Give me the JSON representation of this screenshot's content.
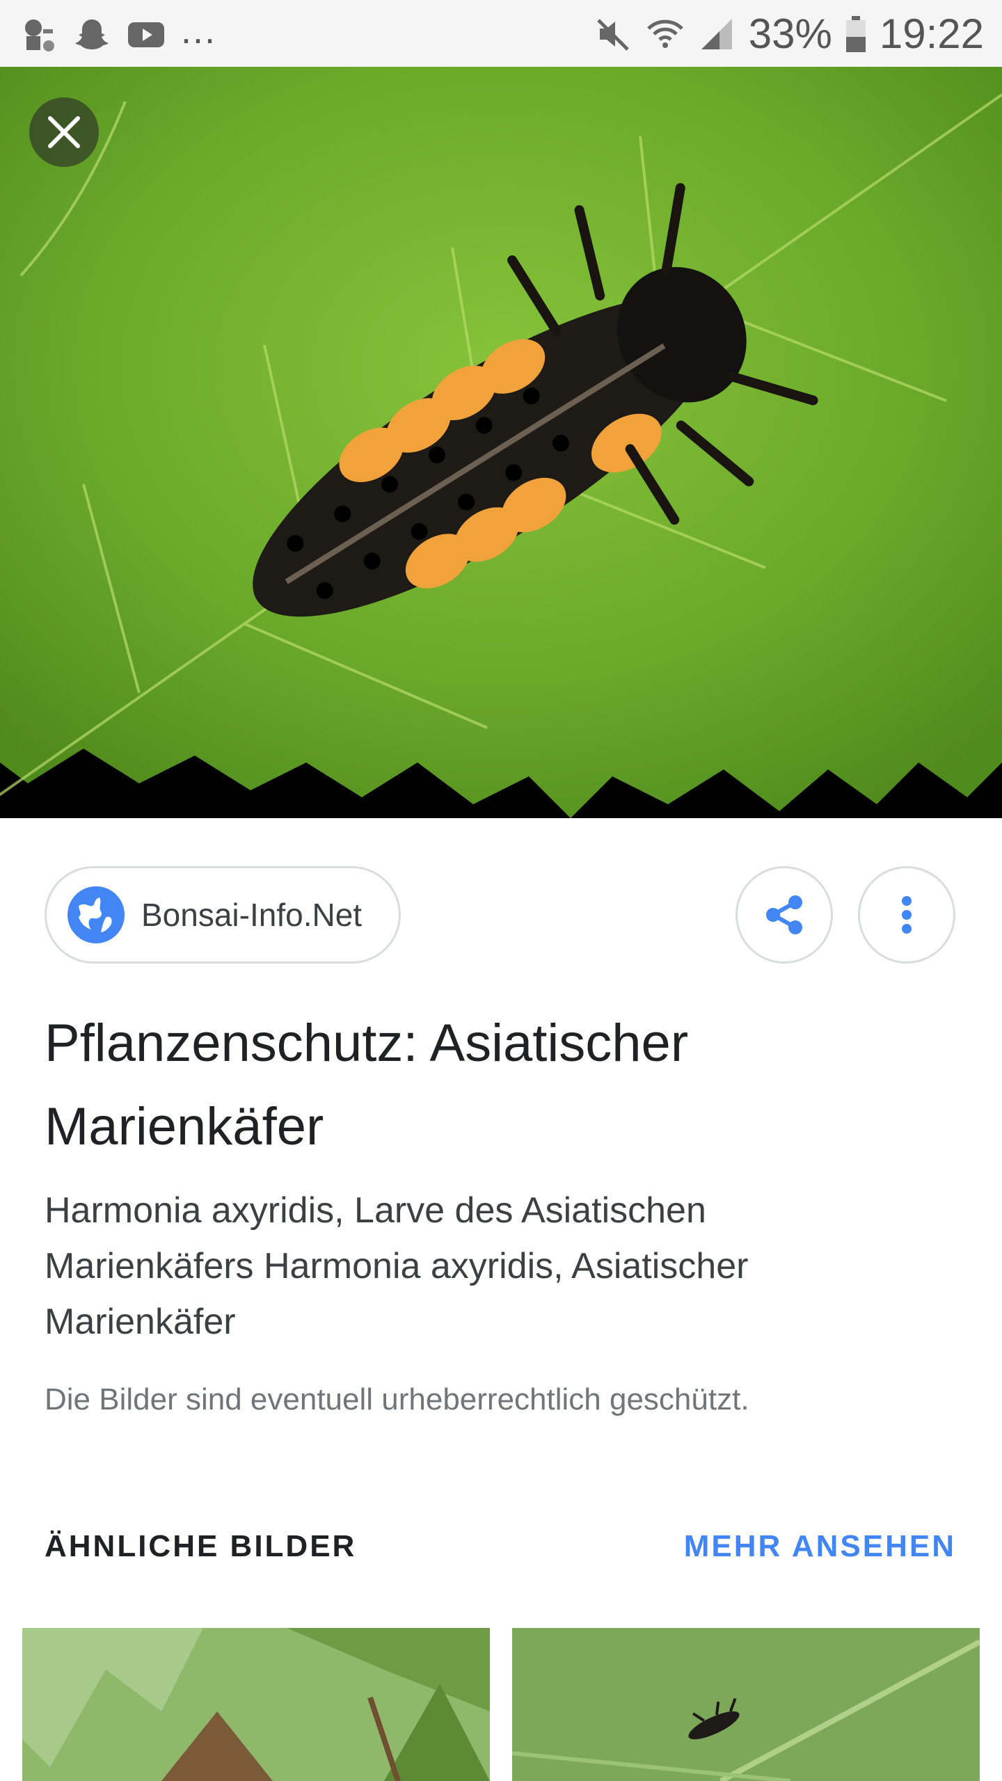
{
  "status_bar": {
    "left_icons": [
      "meme-avatar-icon",
      "snapchat-icon",
      "youtube-icon"
    ],
    "overflow": "...",
    "right_icons": [
      "mute-icon",
      "wifi-icon",
      "signal-icon"
    ],
    "battery_percent": "33%",
    "time": "19:22"
  },
  "hero": {
    "close_icon": "close-icon"
  },
  "source": {
    "site_name": "Bonsai-Info.Net",
    "site_icon": "globe-icon",
    "share_icon": "share-icon",
    "more_icon": "more-vert-icon"
  },
  "result": {
    "title": "Pflanzenschutz: Asiatischer Marienkäfer",
    "description": "Harmonia axyridis, Larve des Asiatischen Marienkäfers Harmonia axyridis, Asiatischer Marienkäfer",
    "copyright_notice": "Die Bilder sind eventuell urheberrechtlich geschützt."
  },
  "similar": {
    "heading": "ÄHNLICHE BILDER",
    "more_link": "MEHR ANSEHEN"
  },
  "colors": {
    "accent": "#4285f4",
    "leaf_green": "#6aa82a",
    "status_bar_bg": "#f5f5f5"
  }
}
